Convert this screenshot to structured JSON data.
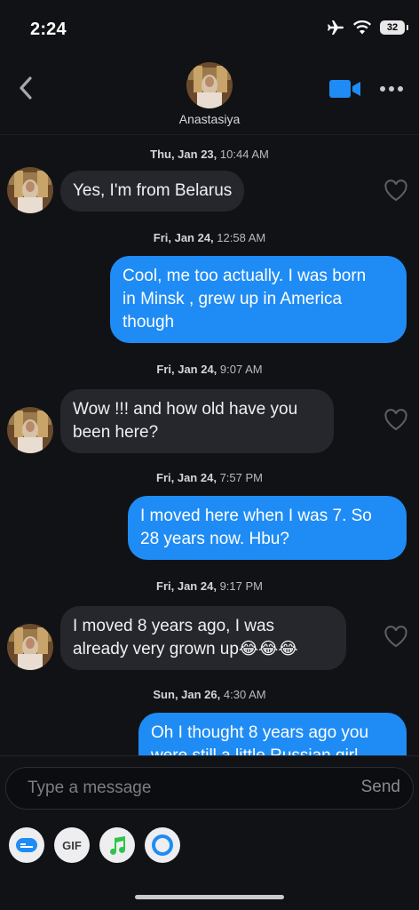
{
  "status_bar": {
    "time": "2:24",
    "battery": "32"
  },
  "header": {
    "contact_name": "Anastasiya",
    "icons": [
      "back-icon",
      "video-call-icon",
      "more-icon"
    ]
  },
  "colors": {
    "outgoing_bubble": "#1f8cf5",
    "incoming_bubble": "#26272c",
    "background": "#111216"
  },
  "messages": [
    {
      "timestamp_day": "Thu, Jan 23,",
      "timestamp_time": "10:44 AM",
      "direction": "in",
      "lines": [
        "Yes, I'm from Belarus"
      ]
    },
    {
      "timestamp_day": "Fri, Jan 24,",
      "timestamp_time": "12:58 AM",
      "direction": "out",
      "lines": [
        "Cool, me too actually. I was born",
        "in Minsk , grew up in America",
        "though"
      ]
    },
    {
      "timestamp_day": "Fri, Jan 24,",
      "timestamp_time": "9:07 AM",
      "direction": "in",
      "lines": [
        "Wow !!! and how old have you",
        "been here?"
      ]
    },
    {
      "timestamp_day": "Fri, Jan 24,",
      "timestamp_time": "7:57 PM",
      "direction": "out",
      "lines": [
        "I moved here when I was 7. So",
        "28 years now. Hbu?"
      ]
    },
    {
      "timestamp_day": "Fri, Jan 24,",
      "timestamp_time": "9:17 PM",
      "direction": "in",
      "lines": [
        "I moved 8 years ago, I was",
        "already very grown up😂😂😂"
      ]
    },
    {
      "timestamp_day": "Sun, Jan 26,",
      "timestamp_time": "4:30 AM",
      "direction": "out",
      "lines": [
        "Oh I thought 8 years ago you",
        "were still a little Russian girl"
      ]
    }
  ],
  "composer": {
    "placeholder": "Type a message",
    "send_label": "Send"
  },
  "tools": {
    "gif_label": "GIF",
    "icons": [
      "sticker-icon",
      "gif-icon",
      "music-icon",
      "loop-icon"
    ]
  }
}
